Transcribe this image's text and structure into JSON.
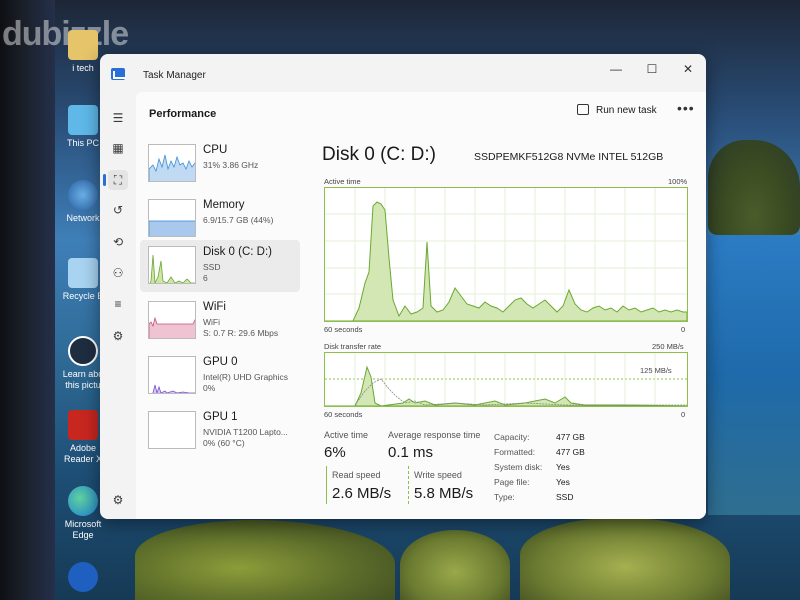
{
  "desktop": {
    "watermark": "dubizzle",
    "icons": [
      {
        "label": "i tech"
      },
      {
        "label": "This PC"
      },
      {
        "label": "Network"
      },
      {
        "label": "Recycle B"
      },
      {
        "label_line1": "Learn abo",
        "label_line2": "this pictu"
      },
      {
        "label_line1": "Adobe",
        "label_line2": "Reader X"
      },
      {
        "label_line1": "Microsoft",
        "label_line2": "Edge"
      },
      {
        "label": ""
      }
    ]
  },
  "window": {
    "title": "Task Manager",
    "controls": {
      "minimize": "—",
      "maximize": "☐",
      "close": "✕"
    }
  },
  "sidebar_icons": [
    "hamburger-icon",
    "processes-icon",
    "performance-icon",
    "app-history-icon",
    "startup-icon",
    "users-icon",
    "details-icon",
    "services-icon",
    "settings-icon"
  ],
  "header": {
    "page_title": "Performance",
    "run_new_task": "Run new task",
    "more": "•••"
  },
  "devices": [
    {
      "name": "CPU",
      "sub1": "31%  3.86 GHz",
      "sub2": ""
    },
    {
      "name": "Memory",
      "sub1": "6.9/15.7 GB (44%)",
      "sub2": ""
    },
    {
      "name": "Disk 0 (C: D:)",
      "sub1": "SSD",
      "sub2": "6"
    },
    {
      "name": "WiFi",
      "sub1": "WiFi",
      "sub2": "S: 0.7  R: 29.6 Mbps"
    },
    {
      "name": "GPU 0",
      "sub1": "Intel(R) UHD Graphics",
      "sub2": "0%"
    },
    {
      "name": "GPU 1",
      "sub1": "NVIDIA T1200 Lapto...",
      "sub2": "0% (60 °C)"
    }
  ],
  "detail": {
    "title": "Disk 0 (C: D:)",
    "model": "SSDPEMKF512G8 NVMe INTEL 512GB",
    "active_time_label": "Active time",
    "active_time_max": "100%",
    "graph1_left": "60 seconds",
    "graph1_right": "0",
    "transfer_label": "Disk transfer rate",
    "transfer_max": "250 MB/s",
    "transfer_mid": "125 MB/s",
    "graph2_left": "60 seconds",
    "graph2_right": "0",
    "active_time_title": "Active time",
    "active_time_value": "6%",
    "avg_response_title": "Average response time",
    "avg_response_value": "0.1 ms",
    "read_speed_title": "Read speed",
    "read_speed_value": "2.6 MB/s",
    "write_speed_title": "Write speed",
    "write_speed_value": "5.8 MB/s",
    "props": [
      {
        "key": "Capacity:",
        "value": "477 GB"
      },
      {
        "key": "Formatted:",
        "value": "477 GB"
      },
      {
        "key": "System disk:",
        "value": "Yes"
      },
      {
        "key": "Page file:",
        "value": "Yes"
      },
      {
        "key": "Type:",
        "value": "SSD"
      }
    ]
  },
  "colors": {
    "accent": "#2a6fd6",
    "disk_green": "#8dbf4a",
    "cpu_blue": "#3d8fd6",
    "wifi_pink": "#c4527a",
    "gpu_purple": "#7a4fd6"
  }
}
